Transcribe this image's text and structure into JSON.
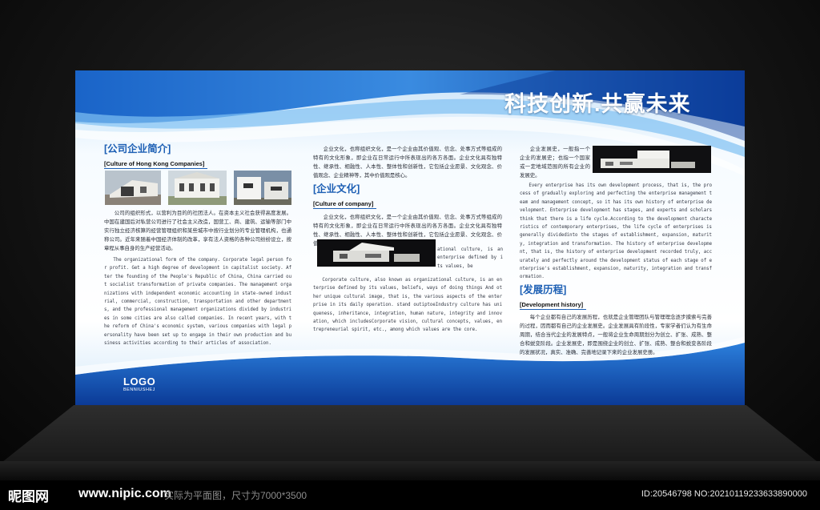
{
  "board": {
    "title": "科技创新.共赢未来",
    "logo": {
      "main": "LOGO",
      "sub": "BENNIUSHEJ"
    }
  },
  "col1": {
    "heading": "[公司企业简介]",
    "subheading": "[Culture of Hong Kong Companies]",
    "zh": "公司的组织形式，以营利为目的的社团法人。在资本主义社会获得高度发展。中国在建国后对私营公司进行了社会主义改造，国营工、商、建筑、运输等部门中实行独立经济核算的经营管理组织和某些城市中按行业划分的专业管理机构，也通称公司。近年来随着中国经济体制的改革，享有法人资格的各种公司纷纷设立，按章程从事自身的生产经营活动。",
    "en": "The organizational form of the company. Corporate legal person for profit. Get a high degree of development in capitalist society. After the founding of the People's Republic of China, China carried out socialist transformation of private companies. The management organizations with independent economic accounting in state-owned industrial, commercial, construction, transportation and other departments, and the professional management organizations divided by industries in some cities are also called companies. In recent years, with the reform of China's economic system, various companies with legal personality have been set up to engage in their own production and business activities according to their articles of association."
  },
  "col2": {
    "zh_top": "企业文化，也称组织文化，是一个企业由其价值观、信念、处事方式等组成的特有的文化形象，即企业在日常运行中所表现出的各方各面。企业文化具有独特性、继承性、相融性、人本性、整体性和创新性，它包括企业愿景、文化观念、价值观念、企业精神等，其中价值观是核心。",
    "heading": "[企业文化]",
    "subheading": "[Culture of company]",
    "zh": "企业文化，也称组织文化，是一个企业由其价值观、信念、处事方式等组成的特有的文化形象，即企业在日常运行中所表现出的各方各面。企业文化具有独特性、继承性、相融性、人本性、整体性和创新性，它包括企业愿景、文化观念、价值观念、企业精神等，其中价值观是核心。",
    "en_side": "ational culture, is an enterprise defined by its values, be",
    "en": "Corporate culture, also known as organizational culture, is an enterprise defined by its values, beliefs, ways of doing things And other unique cultural image, that is, the various aspects of the enterprise in its daily operation. stand outiptoeIndustry culture has uniqueness, inheritance, integration, human nature, integrity and innovation, which includesCorporate vision, cultural concepts, values, entrepreneurial spirit, etc., among which values are the core."
  },
  "col3": {
    "zh_top": "企业发展史，一般指一个企业的发展史；也指一个国家或一定地域范围的所有企业的发展史。",
    "en": "Every enterprise has its own development process, that is, the process of gradually exploring and perfecting the enterprise management team and management concept, so it has its own history of enterprise development. Enterprise development has stages, and experts and scholars think that there is a life cycle.According to the development characteristics of contemporary enterprises, the life cycle of enterprises is generally dividedinto the stages of establishment, expansion, maturity, integration and transformation. The history of enterprise development, that is, the history of enterprise development recorded truly, accurately and perfectly around the development status of each stage of enterprise's establishment, expansion, maturity, integration and transformation.",
    "heading": "[发展历程]",
    "subheading": "[Development history]",
    "zh": "每个企业都有自己的发展历程，也就是企业管理团队与管理理念逐步摸索与完善的过程，因而都有自己的企业发展史。企业发展具有阶段性，专家学者们认为有生命周期，结合当代企业的发展特点，一般将企业生命周期划分为创立、扩张、成熟、整合和蜕变阶段。企业发展史，即是围绕企业的创立、扩张、成熟、整合和蜕变各阶段的发展状况，真实、准确、完善地记录下来的企业发展史册。"
  },
  "footer": {
    "brand": "昵图网",
    "url": "www.nipic.com",
    "note": "实际为平面图，尺寸为7000*3500",
    "id": "ID:20546798 NO:20210119233633890000"
  }
}
